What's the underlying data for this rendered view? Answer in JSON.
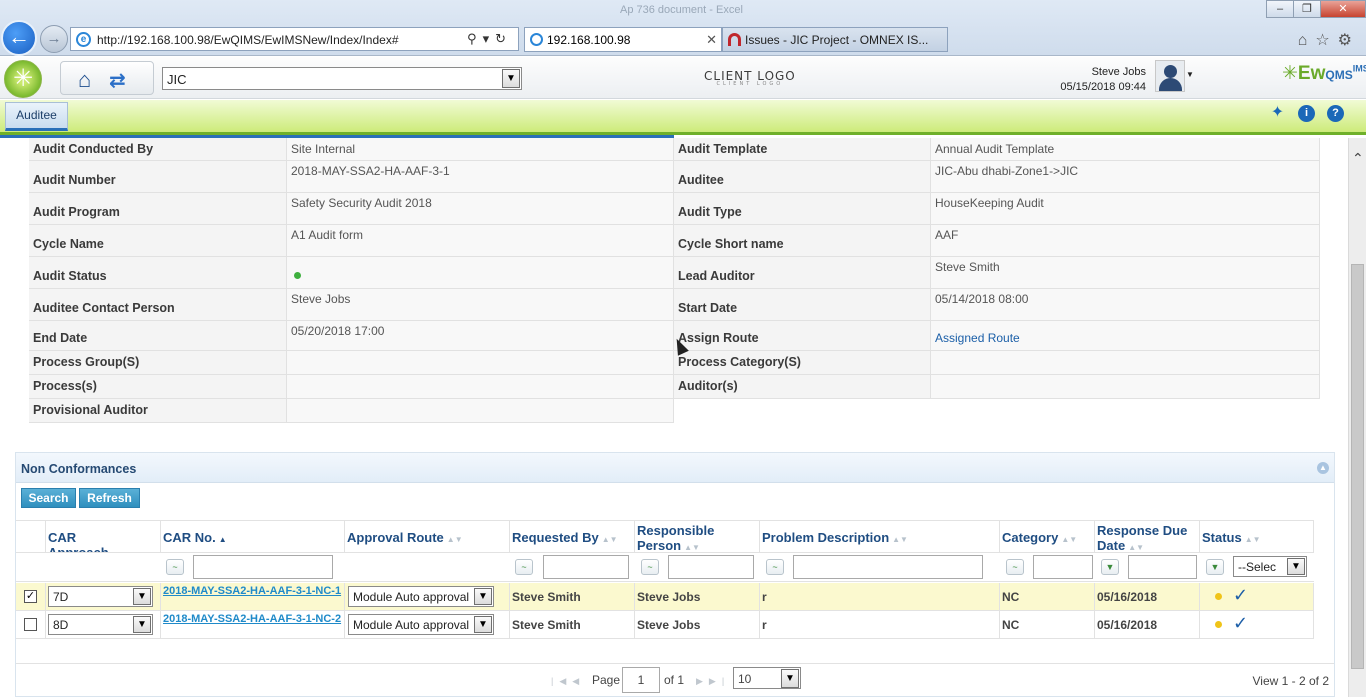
{
  "browser": {
    "window_title": "Ap 736 document - Excel",
    "address": "http://192.168.100.98/EwQIMS/EwIMSNew/Index/Index#",
    "tabs": [
      {
        "label": "192.168.100.98"
      },
      {
        "label": "Issues - JIC Project - OMNEX IS..."
      }
    ]
  },
  "header": {
    "site": "JIC",
    "client_logo": "CLIENT LOGO",
    "client_logo_sub": "CLIENT LOGO",
    "user_name": "Steve Jobs",
    "datetime": "05/15/2018 09:44",
    "brand": "Ew",
    "brand_q": "QMS",
    "brand_sup": "IMS"
  },
  "module_tab": "Auditee",
  "details": {
    "rows": [
      {
        "l1": "Audit Conducted By",
        "v1": "Site Internal",
        "l2": "Audit Template",
        "v2": "Annual Audit Template"
      },
      {
        "l1": "Audit Number",
        "v1": "2018-MAY-SSA2-HA-AAF-3-1",
        "l2": "Auditee",
        "v2": "JIC-Abu dhabi-Zone1->JIC"
      },
      {
        "l1": "Audit Program",
        "v1": "Safety Security Audit 2018",
        "l2": "Audit Type",
        "v2": "HouseKeeping Audit"
      },
      {
        "l1": "Cycle Name",
        "v1": "A1 Audit form",
        "l2": "Cycle Short name",
        "v2": "AAF"
      },
      {
        "l1": "Audit Status",
        "v1": "",
        "l2": "Lead Auditor",
        "v2": "Steve Smith"
      },
      {
        "l1": "Auditee Contact Person",
        "v1": "Steve Jobs",
        "l2": "Start Date",
        "v2": "05/14/2018 08:00"
      },
      {
        "l1": "End Date",
        "v1": "05/20/2018 17:00",
        "l2": "Assign Route",
        "v2": "Assigned Route"
      },
      {
        "l1": "Process Group(S)",
        "v1": "",
        "l2": "Process Category(S)",
        "v2": ""
      },
      {
        "l1": "Process(s)",
        "v1": "",
        "l2": "Auditor(s)",
        "v2": ""
      },
      {
        "l1": "Provisional Auditor",
        "v1": ""
      }
    ],
    "colors": {
      "status": "#3eaf3e"
    }
  },
  "nc": {
    "title": "Non Conformances",
    "search_label": "Search",
    "refresh_label": "Refresh",
    "columns": {
      "car_approach": "CAR Approach",
      "car_no": "CAR No.",
      "approval_route": "Approval Route",
      "requested_by": "Requested By",
      "responsible_person_1": "Responsible",
      "responsible_person_2": "Person",
      "problem_description": "Problem Description",
      "category": "Category",
      "response_due_1": "Response Due",
      "response_due_2": "Date",
      "status": "Status"
    },
    "status_filter": "--Selec",
    "rows": [
      {
        "checked": true,
        "approach": "7D",
        "car_no": "2018-MAY-SSA2-HA-AAF-3-1-NC-1",
        "route": "Module Auto approval",
        "requested_by": "Steve Smith",
        "responsible": "Steve Jobs",
        "problem": "r",
        "category": "NC",
        "due": "05/16/2018"
      },
      {
        "checked": false,
        "approach": "8D",
        "car_no": "2018-MAY-SSA2-HA-AAF-3-1-NC-2",
        "route": "Module Auto approval",
        "requested_by": "Steve Smith",
        "responsible": "Steve Jobs",
        "problem": "r",
        "category": "NC",
        "due": "05/16/2018"
      }
    ],
    "pager": {
      "page_label": "Page",
      "page": "1",
      "of_label": "of 1",
      "page_size": "10",
      "view_info": "View 1 - 2 of 2"
    }
  }
}
